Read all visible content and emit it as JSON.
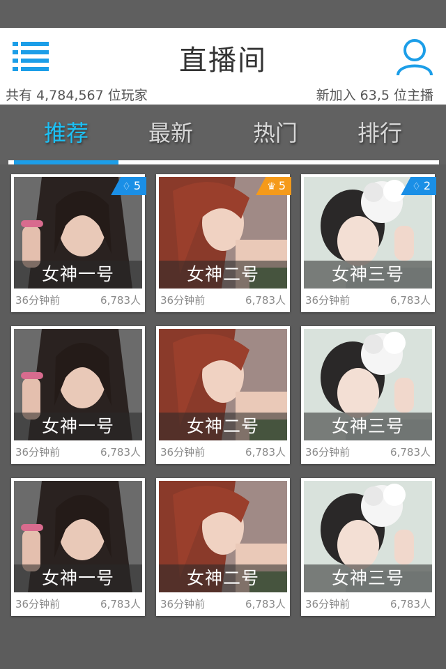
{
  "header": {
    "title": "直播间",
    "players_text": "共有 4,784,567 位玩家",
    "hosts_text": "新加入 63,5 位主播"
  },
  "tabs": [
    {
      "label": "推荐",
      "active": true
    },
    {
      "label": "最新",
      "active": false
    },
    {
      "label": "热门",
      "active": false
    },
    {
      "label": "排行",
      "active": false
    }
  ],
  "colors": {
    "accent": "#1cc0f5",
    "indicator": "#1c9ee8",
    "badge_blue": "#1a8fe6",
    "badge_orange": "#f59a1a"
  },
  "cards": [
    {
      "name": "女神一号",
      "time": "36分钟前",
      "viewers": "6,783人",
      "badge": {
        "icon": "diamond-icon",
        "value": "5",
        "color": "blue"
      }
    },
    {
      "name": "女神二号",
      "time": "36分钟前",
      "viewers": "6,783人",
      "badge": {
        "icon": "crown-icon",
        "value": "5",
        "color": "orange"
      }
    },
    {
      "name": "女神三号",
      "time": "36分钟前",
      "viewers": "6,783人",
      "badge": {
        "icon": "diamond-icon",
        "value": "2",
        "color": "blue"
      }
    },
    {
      "name": "女神一号",
      "time": "36分钟前",
      "viewers": "6,783人"
    },
    {
      "name": "女神二号",
      "time": "36分钟前",
      "viewers": "6,783人"
    },
    {
      "name": "女神三号",
      "time": "36分钟前",
      "viewers": "6,783人"
    },
    {
      "name": "女神一号",
      "time": "36分钟前",
      "viewers": "6,783人"
    },
    {
      "name": "女神二号",
      "time": "36分钟前",
      "viewers": "6,783人"
    },
    {
      "name": "女神三号",
      "time": "36分钟前",
      "viewers": "6,783人"
    }
  ]
}
